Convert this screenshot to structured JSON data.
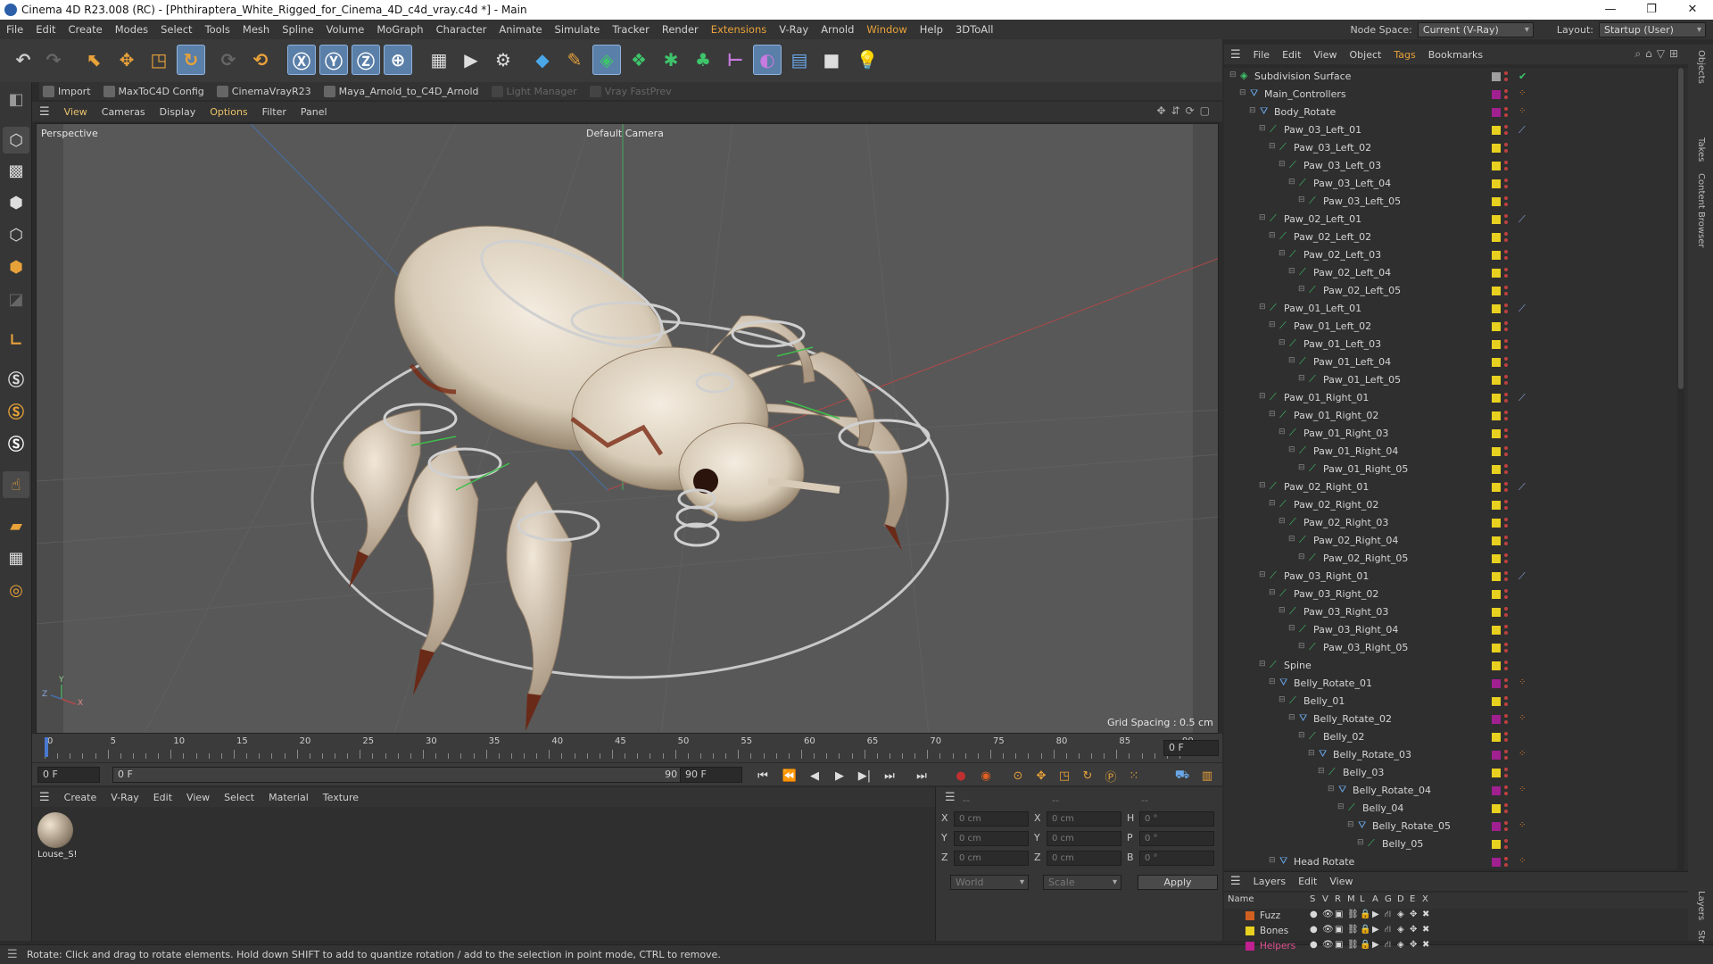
{
  "window": {
    "title": "Cinema 4D R23.008 (RC) - [Phthiraptera_White_Rigged_for_Cinema_4D_c4d_vray.c4d *] - Main",
    "controls": [
      "—",
      "❐",
      "✕"
    ]
  },
  "menubar": {
    "items": [
      "File",
      "Edit",
      "Create",
      "Modes",
      "Select",
      "Tools",
      "Mesh",
      "Spline",
      "Volume",
      "MoGraph",
      "Character",
      "Animate",
      "Simulate",
      "Tracker",
      "Render",
      "Extensions",
      "V-Ray",
      "Arnold",
      "Window",
      "Help",
      "3DToAll"
    ],
    "node_space_label": "Node Space:",
    "node_space_value": "Current (V-Ray)",
    "layout_label": "Layout:",
    "layout_value": "Startup (User)"
  },
  "pluginbar": {
    "items": [
      "Import",
      "MaxToC4D Config",
      "CinemaVrayR23",
      "Maya_Arnold_to_C4D_Arnold",
      "Light Manager",
      "Vray FastPrev"
    ]
  },
  "viewport": {
    "menu": [
      "View",
      "Cameras",
      "Display",
      "Options",
      "Filter",
      "Panel"
    ],
    "projection": "Perspective",
    "camera": "Default Camera",
    "grid_spacing": "Grid Spacing : 0.5 cm",
    "axis_labels": {
      "x": "X",
      "y": "Y",
      "z": "Z"
    }
  },
  "timeline": {
    "ticks": [
      "0",
      "5",
      "10",
      "15",
      "20",
      "25",
      "30",
      "35",
      "40",
      "45",
      "50",
      "55",
      "60",
      "65",
      "70",
      "75",
      "80",
      "85",
      "90"
    ],
    "frame_field": "0 F",
    "start_field": "0 F",
    "current_field": "0 F",
    "end_field": "90 F",
    "max_field": "90 F"
  },
  "material_manager": {
    "menu": [
      "Create",
      "V-Ray",
      "Edit",
      "View",
      "Select",
      "Material",
      "Texture"
    ],
    "materials": [
      "Louse_S!"
    ]
  },
  "coordinates": {
    "headers": [
      "--",
      "--",
      "--"
    ],
    "rows": [
      {
        "a": "X",
        "av": "0 cm",
        "b": "X",
        "bv": "0 cm",
        "c": "H",
        "cv": "0 °"
      },
      {
        "a": "Y",
        "av": "0 cm",
        "b": "Y",
        "bv": "0 cm",
        "c": "P",
        "cv": "0 °"
      },
      {
        "a": "Z",
        "av": "0 cm",
        "b": "Z",
        "bv": "0 cm",
        "c": "B",
        "cv": "0 °"
      }
    ],
    "mode1": "World",
    "mode2": "Scale",
    "apply": "Apply"
  },
  "object_manager": {
    "menu": [
      "File",
      "Edit",
      "View",
      "Object",
      "Tags",
      "Bookmarks"
    ],
    "objects": [
      {
        "name": "Subdivision Surface",
        "depth": 0,
        "icon": "subdivision",
        "color": "#a0a0a0",
        "tag": "check"
      },
      {
        "name": "Main_Controllers",
        "depth": 1,
        "icon": "null",
        "color": "#a02090",
        "tag": "dots"
      },
      {
        "name": "Body_Rotate",
        "depth": 2,
        "icon": "null",
        "color": "#a02090",
        "tag": "dots"
      },
      {
        "name": "Paw_03_Left_01",
        "depth": 3,
        "icon": "bone",
        "color": "#e8d020",
        "tag": "ik"
      },
      {
        "name": "Paw_03_Left_02",
        "depth": 4,
        "icon": "bone",
        "color": "#e8d020",
        "tag": ""
      },
      {
        "name": "Paw_03_Left_03",
        "depth": 5,
        "icon": "bone",
        "color": "#e8d020",
        "tag": ""
      },
      {
        "name": "Paw_03_Left_04",
        "depth": 6,
        "icon": "bone",
        "color": "#e8d020",
        "tag": ""
      },
      {
        "name": "Paw_03_Left_05",
        "depth": 7,
        "icon": "bone",
        "color": "#e8d020",
        "tag": ""
      },
      {
        "name": "Paw_02_Left_01",
        "depth": 3,
        "icon": "bone",
        "color": "#e8d020",
        "tag": "ik"
      },
      {
        "name": "Paw_02_Left_02",
        "depth": 4,
        "icon": "bone",
        "color": "#e8d020",
        "tag": ""
      },
      {
        "name": "Paw_02_Left_03",
        "depth": 5,
        "icon": "bone",
        "color": "#e8d020",
        "tag": ""
      },
      {
        "name": "Paw_02_Left_04",
        "depth": 6,
        "icon": "bone",
        "color": "#e8d020",
        "tag": ""
      },
      {
        "name": "Paw_02_Left_05",
        "depth": 7,
        "icon": "bone",
        "color": "#e8d020",
        "tag": ""
      },
      {
        "name": "Paw_01_Left_01",
        "depth": 3,
        "icon": "bone",
        "color": "#e8d020",
        "tag": "ik"
      },
      {
        "name": "Paw_01_Left_02",
        "depth": 4,
        "icon": "bone",
        "color": "#e8d020",
        "tag": ""
      },
      {
        "name": "Paw_01_Left_03",
        "depth": 5,
        "icon": "bone",
        "color": "#e8d020",
        "tag": ""
      },
      {
        "name": "Paw_01_Left_04",
        "depth": 6,
        "icon": "bone",
        "color": "#e8d020",
        "tag": ""
      },
      {
        "name": "Paw_01_Left_05",
        "depth": 7,
        "icon": "bone",
        "color": "#e8d020",
        "tag": ""
      },
      {
        "name": "Paw_01_Right_01",
        "depth": 3,
        "icon": "bone",
        "color": "#e8d020",
        "tag": "ik"
      },
      {
        "name": "Paw_01_Right_02",
        "depth": 4,
        "icon": "bone",
        "color": "#e8d020",
        "tag": ""
      },
      {
        "name": "Paw_01_Right_03",
        "depth": 5,
        "icon": "bone",
        "color": "#e8d020",
        "tag": ""
      },
      {
        "name": "Paw_01_Right_04",
        "depth": 6,
        "icon": "bone",
        "color": "#e8d020",
        "tag": ""
      },
      {
        "name": "Paw_01_Right_05",
        "depth": 7,
        "icon": "bone",
        "color": "#e8d020",
        "tag": ""
      },
      {
        "name": "Paw_02_Right_01",
        "depth": 3,
        "icon": "bone",
        "color": "#e8d020",
        "tag": "ik"
      },
      {
        "name": "Paw_02_Right_02",
        "depth": 4,
        "icon": "bone",
        "color": "#e8d020",
        "tag": ""
      },
      {
        "name": "Paw_02_Right_03",
        "depth": 5,
        "icon": "bone",
        "color": "#e8d020",
        "tag": ""
      },
      {
        "name": "Paw_02_Right_04",
        "depth": 6,
        "icon": "bone",
        "color": "#e8d020",
        "tag": ""
      },
      {
        "name": "Paw_02_Right_05",
        "depth": 7,
        "icon": "bone",
        "color": "#e8d020",
        "tag": ""
      },
      {
        "name": "Paw_03_Right_01",
        "depth": 3,
        "icon": "bone",
        "color": "#e8d020",
        "tag": "ik"
      },
      {
        "name": "Paw_03_Right_02",
        "depth": 4,
        "icon": "bone",
        "color": "#e8d020",
        "tag": ""
      },
      {
        "name": "Paw_03_Right_03",
        "depth": 5,
        "icon": "bone",
        "color": "#e8d020",
        "tag": ""
      },
      {
        "name": "Paw_03_Right_04",
        "depth": 6,
        "icon": "bone",
        "color": "#e8d020",
        "tag": ""
      },
      {
        "name": "Paw_03_Right_05",
        "depth": 7,
        "icon": "bone",
        "color": "#e8d020",
        "tag": ""
      },
      {
        "name": "Spine",
        "depth": 3,
        "icon": "bone",
        "color": "#e8d020",
        "tag": ""
      },
      {
        "name": "Belly_Rotate_01",
        "depth": 4,
        "icon": "null",
        "color": "#a02090",
        "tag": "dots"
      },
      {
        "name": "Belly_01",
        "depth": 5,
        "icon": "bone",
        "color": "#e8d020",
        "tag": ""
      },
      {
        "name": "Belly_Rotate_02",
        "depth": 6,
        "icon": "null",
        "color": "#a02090",
        "tag": "dots"
      },
      {
        "name": "Belly_02",
        "depth": 7,
        "icon": "bone",
        "color": "#e8d020",
        "tag": ""
      },
      {
        "name": "Belly_Rotate_03",
        "depth": 8,
        "icon": "null",
        "color": "#a02090",
        "tag": "dots"
      },
      {
        "name": "Belly_03",
        "depth": 9,
        "icon": "bone",
        "color": "#e8d020",
        "tag": ""
      },
      {
        "name": "Belly_Rotate_04",
        "depth": 10,
        "icon": "null",
        "color": "#a02090",
        "tag": "dots"
      },
      {
        "name": "Belly_04",
        "depth": 11,
        "icon": "bone",
        "color": "#e8d020",
        "tag": ""
      },
      {
        "name": "Belly_Rotate_05",
        "depth": 12,
        "icon": "null",
        "color": "#a02090",
        "tag": "dots"
      },
      {
        "name": "Belly_05",
        "depth": 13,
        "icon": "bone",
        "color": "#e8d020",
        "tag": ""
      },
      {
        "name": "Head Rotate",
        "depth": 4,
        "icon": "null",
        "color": "#a02090",
        "tag": "dots"
      }
    ]
  },
  "layers": {
    "menu": [
      "Layers",
      "Edit",
      "View"
    ],
    "columns": [
      "Name",
      "S",
      "V",
      "R",
      "M",
      "L",
      "A",
      "G",
      "D",
      "E",
      "X"
    ],
    "items": [
      {
        "name": "Fuzz",
        "color": "#d06020"
      },
      {
        "name": "Bones",
        "color": "#e8d020"
      },
      {
        "name": "Helpers",
        "color": "#c02090"
      }
    ]
  },
  "right_tabs": [
    "Objects",
    "Takes",
    "Content Browser",
    "Layers",
    "Str"
  ],
  "status": {
    "text": "Rotate: Click and drag to rotate elements. Hold down SHIFT to add to quantize rotation / add to the selection in point mode, CTRL to remove."
  }
}
